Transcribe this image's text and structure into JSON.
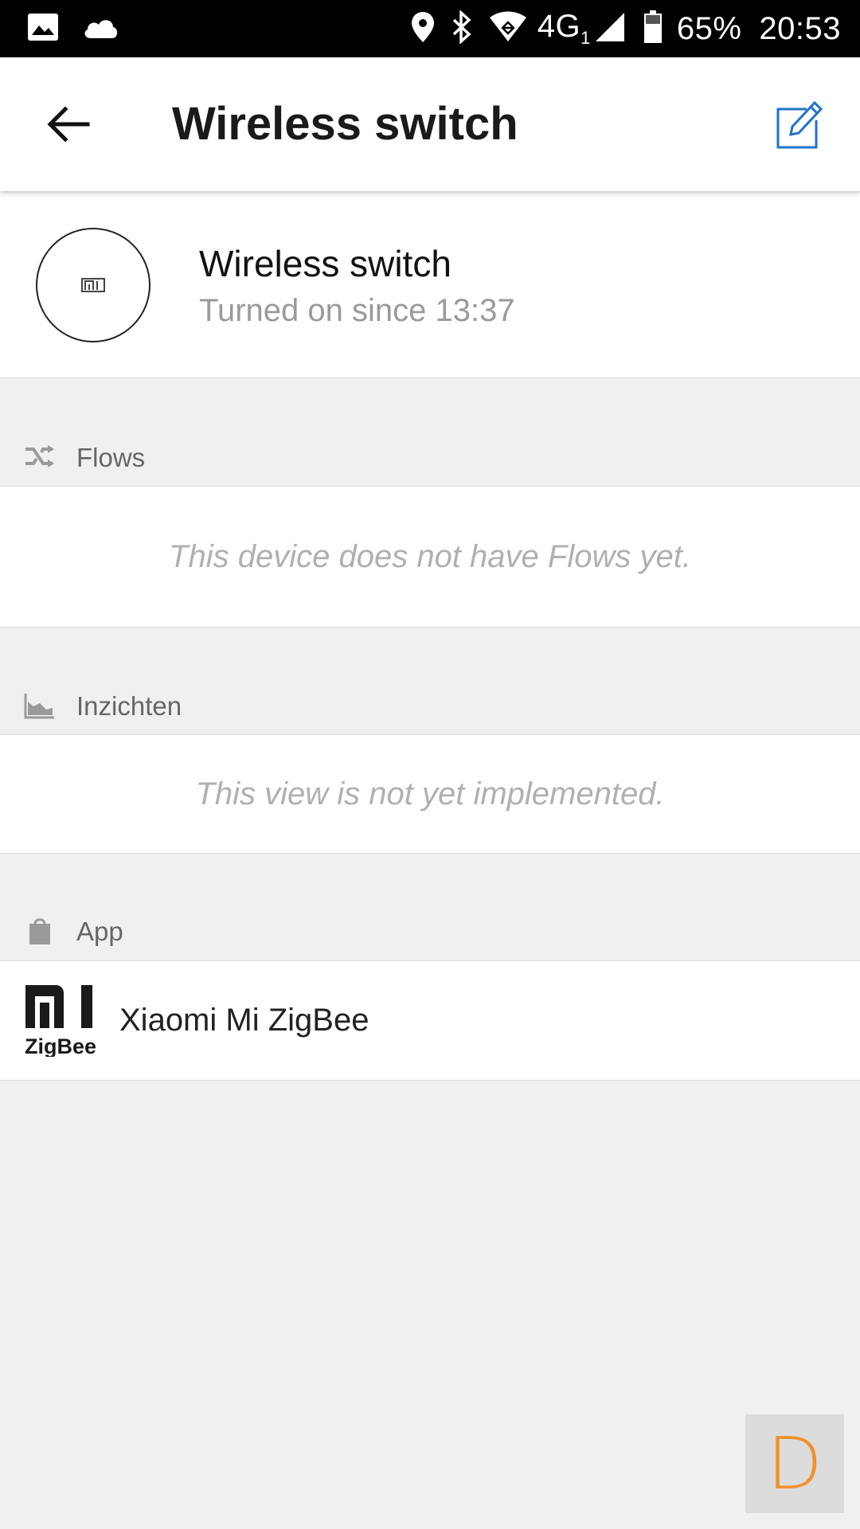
{
  "status_bar": {
    "network": "4G",
    "network_sub": "1",
    "battery": "65%",
    "time": "20:53",
    "icons": [
      "image-icon",
      "cloud-icon",
      "location-icon",
      "bluetooth-icon",
      "wifi-icon",
      "signal-icon",
      "battery-icon"
    ]
  },
  "app_bar": {
    "title": "Wireless switch",
    "back_icon": "arrow-left-icon",
    "edit_icon": "edit-icon",
    "accent_color": "#1e73c8"
  },
  "device": {
    "name": "Wireless switch",
    "status": "Turned on since 13:37",
    "avatar_icon": "mi-logo-icon"
  },
  "sections": {
    "flows": {
      "label": "Flows",
      "icon": "shuffle-icon",
      "empty_text": "This device does not have Flows yet."
    },
    "insights": {
      "label": "Inzichten",
      "icon": "area-chart-icon",
      "empty_text": "This view is not yet implemented."
    },
    "app": {
      "label": "App",
      "icon": "shopping-bag-icon",
      "item_label": "Xiaomi Mi ZigBee",
      "logo_text": "ZigBee"
    }
  },
  "debug_badge": {
    "label": "D",
    "color": "#f0912d"
  }
}
